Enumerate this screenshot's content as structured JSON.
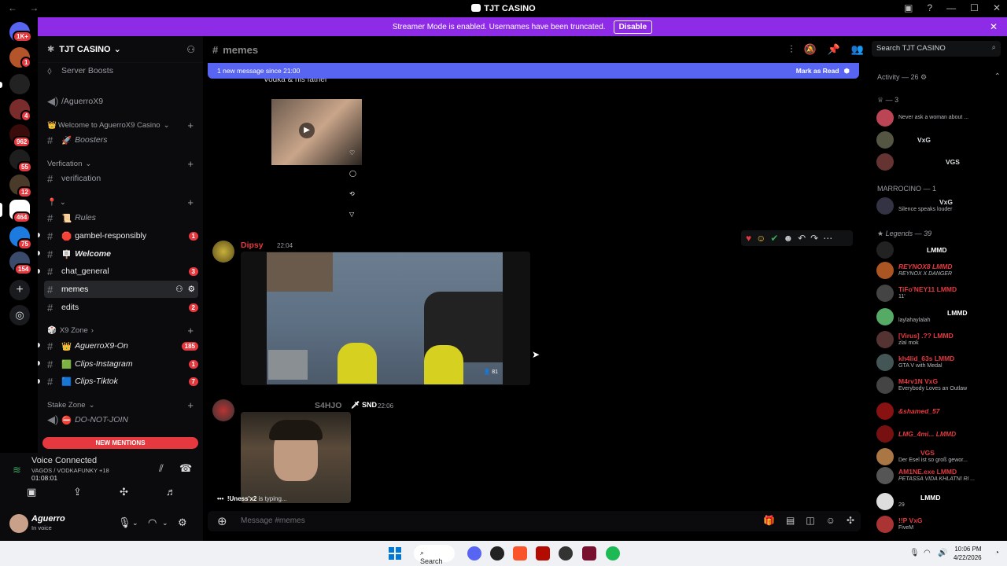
{
  "window": {
    "title": "TJT CASINO",
    "back": "←",
    "forward": "→"
  },
  "banner": {
    "text": "Streamer Mode is enabled. Usernames have been truncated.",
    "disable_label": "Disable"
  },
  "rail": {
    "home_badge": "1K+",
    "badges": [
      "1",
      "4",
      "962",
      "55",
      "12",
      "464",
      "75",
      "154"
    ]
  },
  "server": {
    "name": "TJT CASINO",
    "server_boosts": "Server Boosts",
    "voice_channel_top": "/AguerroX9",
    "categories": {
      "welcome": "Welcome to AguerroX9 Casino",
      "verification": "Verfication",
      "x9zone": "X9 Zone",
      "stake": "Stake Zone"
    },
    "channels": {
      "boosters": "Boosters",
      "verification": "verification",
      "rules": "Rules",
      "gambel": "gambel-responsibly",
      "gambel_count": "1",
      "welcome": "Welcome",
      "chat_general": "chat_general",
      "chat_general_count": "3",
      "memes": "memes",
      "edits": "edits",
      "edits_count": "2",
      "aguerro_on": "AguerroX9-On",
      "aguerro_on_count": "185",
      "clips_instagram": "Clips-Instagram",
      "clips_instagram_count": "1",
      "clips_tiktok": "Clips-Tiktok",
      "clips_tiktok_count": "7",
      "do_not_join": "DO-NOT-JOIN"
    },
    "new_mentions": "NEW MENTIONS"
  },
  "voice": {
    "title": "Voice Connected",
    "channel": "VAGOS / VODKAFUNKY +18",
    "timer": "01:08:01"
  },
  "user": {
    "name": "Aguerro",
    "status": "In voice"
  },
  "chat": {
    "channel": "memes",
    "new_message_bar": "1 new message since 21:00",
    "mark_read": "Mark as Read",
    "top_caption": "Vodka & his father",
    "messages": [
      {
        "author": "Dipsy",
        "time": "22:04",
        "viewers": "81"
      },
      {
        "author": "S4HJO",
        "tag": "SND",
        "time": "22:06"
      }
    ],
    "typing_user": "!Uness'x2",
    "typing_suffix": " is typing...",
    "composer_placeholder": "Message #memes"
  },
  "search": {
    "placeholder": "Search TJT CASINO"
  },
  "members": {
    "activity_header": "Activity — 26",
    "group1_header": "— 3",
    "marrocino_header": "MARROCINO — 1",
    "legends_header": "Legends — 39",
    "items": [
      {
        "name": "",
        "sub": "Never ask a woman about ...",
        "color": "#e5393f"
      },
      {
        "name": "VxG",
        "sub": "",
        "color": "#f0c23b"
      },
      {
        "name": "VGS",
        "sub": "",
        "color": "#f0c23b"
      },
      {
        "name": "VxG",
        "sub": "Silence speaks louder",
        "color": "#f0c23b"
      },
      {
        "name": "LMMD",
        "sub": "",
        "color": "#ffffff"
      },
      {
        "name": "REYNOX8 LMMD",
        "sub": "REYNOX X DANGER",
        "color": "#e5393f"
      },
      {
        "name": "TiFo'NEY11 LMMD",
        "sub": "11'",
        "color": "#e5393f"
      },
      {
        "name": "LMMD",
        "sub": "laylahaylalah",
        "color": "#e5393f"
      },
      {
        "name": "[Virus] .?? LMMD",
        "sub": "zlal mok",
        "color": "#e5393f"
      },
      {
        "name": "kh4lid_63s LMMD",
        "sub": "GTA V with Medal",
        "color": "#e5393f"
      },
      {
        "name": "M4rv1N VxG",
        "sub": "Everybody Loves an Outlaw",
        "color": "#e5393f"
      },
      {
        "name": "&shamed_57",
        "sub": "",
        "color": "#e5393f"
      },
      {
        "name": "LMG_4mi... LMMD",
        "sub": "",
        "color": "#e5393f"
      },
      {
        "name": "VGS",
        "sub": "Der Esel ist so groß gewor...",
        "color": "#e5393f"
      },
      {
        "name": "AM1NE.exe LMMD",
        "sub": "PETASSA VIDA KHLATNI RI ...",
        "color": "#e5393f"
      },
      {
        "name": "LMMD",
        "sub": "29",
        "color": "#e5393f"
      },
      {
        "name": "!!P VxG",
        "sub": "FiveM",
        "color": "#e5393f"
      }
    ]
  },
  "taskbar": {
    "search": "Search",
    "time": "10:06 PM",
    "date": "4/22/2026"
  },
  "colors": {
    "accent": "#5865f2",
    "banner": "#8e2be6",
    "mention": "#e5393f"
  }
}
